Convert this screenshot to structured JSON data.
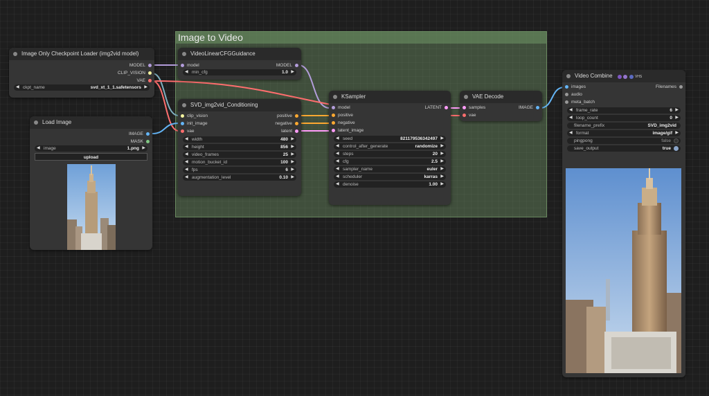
{
  "group": {
    "title": "Image to Video"
  },
  "checkpoint_loader": {
    "title": "Image Only Checkpoint Loader (img2vid model)",
    "outputs": [
      "MODEL",
      "CLIP_VISION",
      "VAE"
    ],
    "widget": {
      "name": "ckpt_name",
      "value": "svd_xt_1_1.safetensors"
    }
  },
  "load_image": {
    "title": "Load Image",
    "outputs": [
      "IMAGE",
      "MASK"
    ],
    "widget": {
      "name": "image",
      "value": "1.png"
    },
    "upload_label": "upload"
  },
  "cfg_guidance": {
    "title": "VideoLinearCFGGuidance",
    "input": "model",
    "output": "MODEL",
    "widget": {
      "name": "min_cfg",
      "value": "1.0"
    }
  },
  "conditioning": {
    "title": "SVD_img2vid_Conditioning",
    "inputs": [
      "clip_vision",
      "init_image",
      "vae"
    ],
    "outputs": [
      "positive",
      "negative",
      "latent"
    ],
    "widgets": [
      {
        "name": "width",
        "value": "480"
      },
      {
        "name": "height",
        "value": "856"
      },
      {
        "name": "video_frames",
        "value": "25"
      },
      {
        "name": "motion_bucket_id",
        "value": "100"
      },
      {
        "name": "fps",
        "value": "6"
      },
      {
        "name": "augmentation_level",
        "value": "0.10"
      }
    ]
  },
  "ksampler": {
    "title": "KSampler",
    "inputs": [
      "model",
      "positive",
      "negative",
      "latent_image"
    ],
    "output": "LATENT",
    "widgets": [
      {
        "name": "seed",
        "value": "821179536342497"
      },
      {
        "name": "control_after_generate",
        "value": "randomize"
      },
      {
        "name": "steps",
        "value": "20"
      },
      {
        "name": "cfg",
        "value": "2.5"
      },
      {
        "name": "sampler_name",
        "value": "euler"
      },
      {
        "name": "scheduler",
        "value": "karras"
      },
      {
        "name": "denoise",
        "value": "1.00"
      }
    ]
  },
  "vae_decode": {
    "title": "VAE Decode",
    "inputs": [
      "samples",
      "vae"
    ],
    "output": "IMAGE"
  },
  "video_combine": {
    "title": "Video Combine",
    "badge_label": "VHS",
    "inputs": [
      "images",
      "audio",
      "meta_batch"
    ],
    "output": "Filenames",
    "widgets": [
      {
        "name": "frame_rate",
        "value": "6"
      },
      {
        "name": "loop_count",
        "value": "0"
      },
      {
        "name": "filename_prefix",
        "value": "SVD_img2vid"
      },
      {
        "name": "format",
        "value": "image/gif"
      },
      {
        "name": "pingpong",
        "value": "false"
      },
      {
        "name": "save_output",
        "value": "true"
      }
    ]
  },
  "colors": {
    "model": "#b39ddb",
    "clip_vision": "#f5f5a0",
    "vae": "#ff6e6e",
    "image": "#64b5f6",
    "mask": "#81c784",
    "conditioning": "#ffa931",
    "latent": "#ff9cf9"
  }
}
